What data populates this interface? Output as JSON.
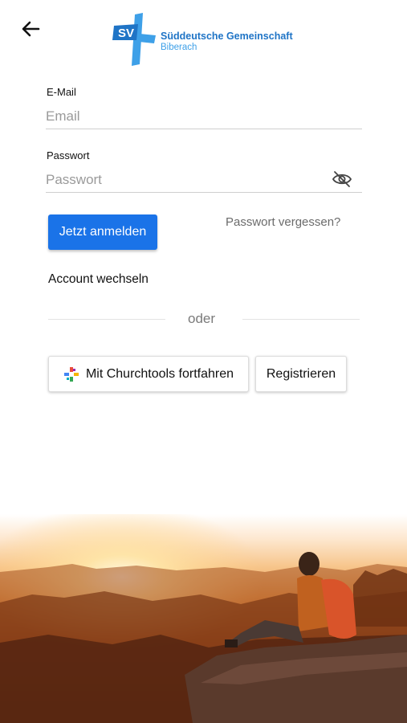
{
  "header": {
    "logo_badge": "SV",
    "logo_title": "Süddeutsche Gemeinschaft",
    "logo_subtitle": "Biberach",
    "back_icon": "arrow-left-icon"
  },
  "form": {
    "email_label": "E-Mail",
    "email_placeholder": "Email",
    "password_label": "Passwort",
    "password_placeholder": "Passwort",
    "password_toggle_icon": "eye-off-icon",
    "login_button": "Jetzt anmelden",
    "forgot_password": "Passwort vergessen?",
    "switch_account": "Account wechseln"
  },
  "alt_login": {
    "divider_text": "oder",
    "churchtools_button": "Mit Churchtools fortfahren",
    "churchtools_icon": "churchtools-icon",
    "register_button": "Registrieren"
  },
  "colors": {
    "primary": "#1a73e8",
    "logo_blue": "#1f74c6",
    "logo_light_blue": "#3ea0e8"
  }
}
